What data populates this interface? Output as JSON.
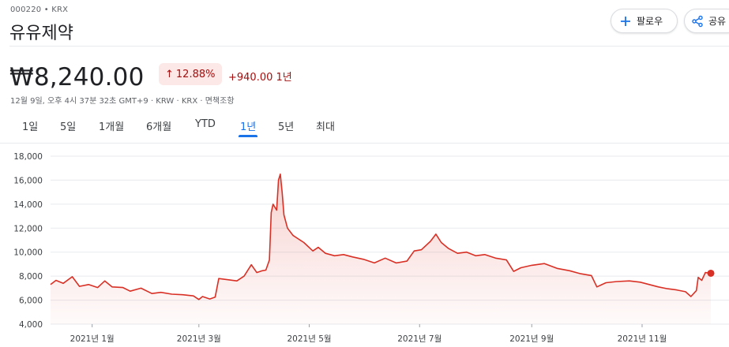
{
  "header": {
    "ticker": "000220 • KRX",
    "company": "유유제약",
    "follow_label": "팔로우",
    "share_label": "공유"
  },
  "quote": {
    "price": "₩8,240.00",
    "percent": "12.88%",
    "change": "+940.00 1년",
    "meta": "12월 9일, 오후 4시 37분 32초 GMT+9 · KRW · KRX · 면책조항"
  },
  "tabs": [
    {
      "label": "1일"
    },
    {
      "label": "5일"
    },
    {
      "label": "1개월"
    },
    {
      "label": "6개월"
    },
    {
      "label": "YTD"
    },
    {
      "label": "1년"
    },
    {
      "label": "5년"
    },
    {
      "label": "최대"
    }
  ],
  "colors": {
    "up": "#d93025",
    "up_text": "#a50e0e",
    "accent": "#1a73e8",
    "grid": "#e8eaed"
  },
  "icons": {
    "follow": "plus-icon",
    "share": "share-icon",
    "change_arrow": "arrow-up-icon"
  },
  "chart_data": {
    "type": "area",
    "ylim": [
      4000,
      18000
    ],
    "y_ticks": [
      "4,000",
      "6,000",
      "8,000",
      "10,000",
      "12,000",
      "14,000",
      "16,000",
      "18,000"
    ],
    "x_ticks": [
      "2021년 1월",
      "2021년 3월",
      "2021년 5월",
      "2021년 7월",
      "2021년 9월",
      "2021년 11월"
    ],
    "x_range": [
      "2020-12-09",
      "2021-12-09"
    ],
    "series": [
      {
        "values": [
          [
            "2020-12-09",
            7300
          ],
          [
            "2020-12-12",
            7650
          ],
          [
            "2020-12-16",
            7400
          ],
          [
            "2020-12-21",
            7950
          ],
          [
            "2020-12-25",
            7150
          ],
          [
            "2020-12-30",
            7300
          ],
          [
            "2021-01-04",
            7050
          ],
          [
            "2021-01-08",
            7600
          ],
          [
            "2021-01-12",
            7100
          ],
          [
            "2021-01-18",
            7050
          ],
          [
            "2021-01-22",
            6750
          ],
          [
            "2021-01-28",
            7000
          ],
          [
            "2021-02-03",
            6550
          ],
          [
            "2021-02-08",
            6650
          ],
          [
            "2021-02-14",
            6500
          ],
          [
            "2021-02-20",
            6450
          ],
          [
            "2021-02-26",
            6350
          ],
          [
            "2021-03-01",
            6050
          ],
          [
            "2021-03-03",
            6300
          ],
          [
            "2021-03-07",
            6100
          ],
          [
            "2021-03-10",
            6250
          ],
          [
            "2021-03-12",
            7800
          ],
          [
            "2021-03-17",
            7700
          ],
          [
            "2021-03-22",
            7600
          ],
          [
            "2021-03-26",
            8000
          ],
          [
            "2021-03-30",
            8950
          ],
          [
            "2021-04-02",
            8300
          ],
          [
            "2021-04-05",
            8450
          ],
          [
            "2021-04-07",
            8500
          ],
          [
            "2021-04-09",
            9350
          ],
          [
            "2021-04-10",
            13300
          ],
          [
            "2021-04-11",
            14000
          ],
          [
            "2021-04-13",
            13500
          ],
          [
            "2021-04-14",
            16000
          ],
          [
            "2021-04-15",
            16500
          ],
          [
            "2021-04-16",
            15000
          ],
          [
            "2021-04-17",
            13100
          ],
          [
            "2021-04-19",
            12000
          ],
          [
            "2021-04-22",
            11400
          ],
          [
            "2021-04-25",
            11100
          ],
          [
            "2021-04-28",
            10800
          ],
          [
            "2021-05-03",
            10100
          ],
          [
            "2021-05-06",
            10400
          ],
          [
            "2021-05-10",
            9900
          ],
          [
            "2021-05-15",
            9700
          ],
          [
            "2021-05-20",
            9800
          ],
          [
            "2021-05-25",
            9600
          ],
          [
            "2021-05-31",
            9400
          ],
          [
            "2021-06-06",
            9100
          ],
          [
            "2021-06-12",
            9500
          ],
          [
            "2021-06-18",
            9100
          ],
          [
            "2021-06-24",
            9250
          ],
          [
            "2021-06-28",
            10100
          ],
          [
            "2021-07-02",
            10200
          ],
          [
            "2021-07-07",
            10900
          ],
          [
            "2021-07-10",
            11500
          ],
          [
            "2021-07-13",
            10800
          ],
          [
            "2021-07-17",
            10300
          ],
          [
            "2021-07-22",
            9900
          ],
          [
            "2021-07-27",
            10000
          ],
          [
            "2021-08-01",
            9700
          ],
          [
            "2021-08-06",
            9800
          ],
          [
            "2021-08-12",
            9500
          ],
          [
            "2021-08-18",
            9350
          ],
          [
            "2021-08-22",
            8400
          ],
          [
            "2021-08-26",
            8700
          ],
          [
            "2021-09-01",
            8900
          ],
          [
            "2021-09-08",
            9050
          ],
          [
            "2021-09-15",
            8650
          ],
          [
            "2021-09-22",
            8450
          ],
          [
            "2021-09-28",
            8200
          ],
          [
            "2021-10-04",
            8050
          ],
          [
            "2021-10-07",
            7100
          ],
          [
            "2021-10-12",
            7450
          ],
          [
            "2021-10-18",
            7550
          ],
          [
            "2021-10-25",
            7600
          ],
          [
            "2021-10-31",
            7500
          ],
          [
            "2021-11-05",
            7300
          ],
          [
            "2021-11-10",
            7100
          ],
          [
            "2021-11-15",
            6950
          ],
          [
            "2021-11-20",
            6850
          ],
          [
            "2021-11-25",
            6700
          ],
          [
            "2021-11-28",
            6300
          ],
          [
            "2021-12-01",
            6800
          ],
          [
            "2021-12-02",
            7900
          ],
          [
            "2021-12-04",
            7650
          ],
          [
            "2021-12-06",
            8300
          ],
          [
            "2021-12-09",
            8240
          ]
        ]
      }
    ]
  }
}
